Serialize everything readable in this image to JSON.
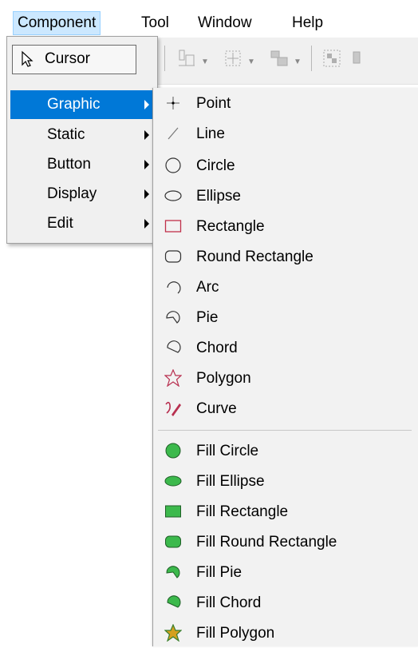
{
  "menubar": {
    "items": [
      "Component",
      "Tool",
      "Window",
      "Help"
    ]
  },
  "component_menu": {
    "cursor_label": "Cursor",
    "items": [
      "Graphic",
      "Static",
      "Button",
      "Display",
      "Edit"
    ]
  },
  "graphic_menu": {
    "items": [
      "Point",
      "Line",
      "Circle",
      "Ellipse",
      "Rectangle",
      "Round Rectangle",
      "Arc",
      "Pie",
      "Chord",
      "Polygon",
      "Curve"
    ],
    "fill_items": [
      "Fill Circle",
      "Fill Ellipse",
      "Fill Rectangle",
      "Fill Round Rectangle",
      "Fill Pie",
      "Fill Chord",
      "Fill Polygon"
    ]
  },
  "colors": {
    "selection": "#0078d7",
    "fill_green": "#3cb94c",
    "outline_red": "#c0304a",
    "menu_bg": "#f0f0f0"
  }
}
